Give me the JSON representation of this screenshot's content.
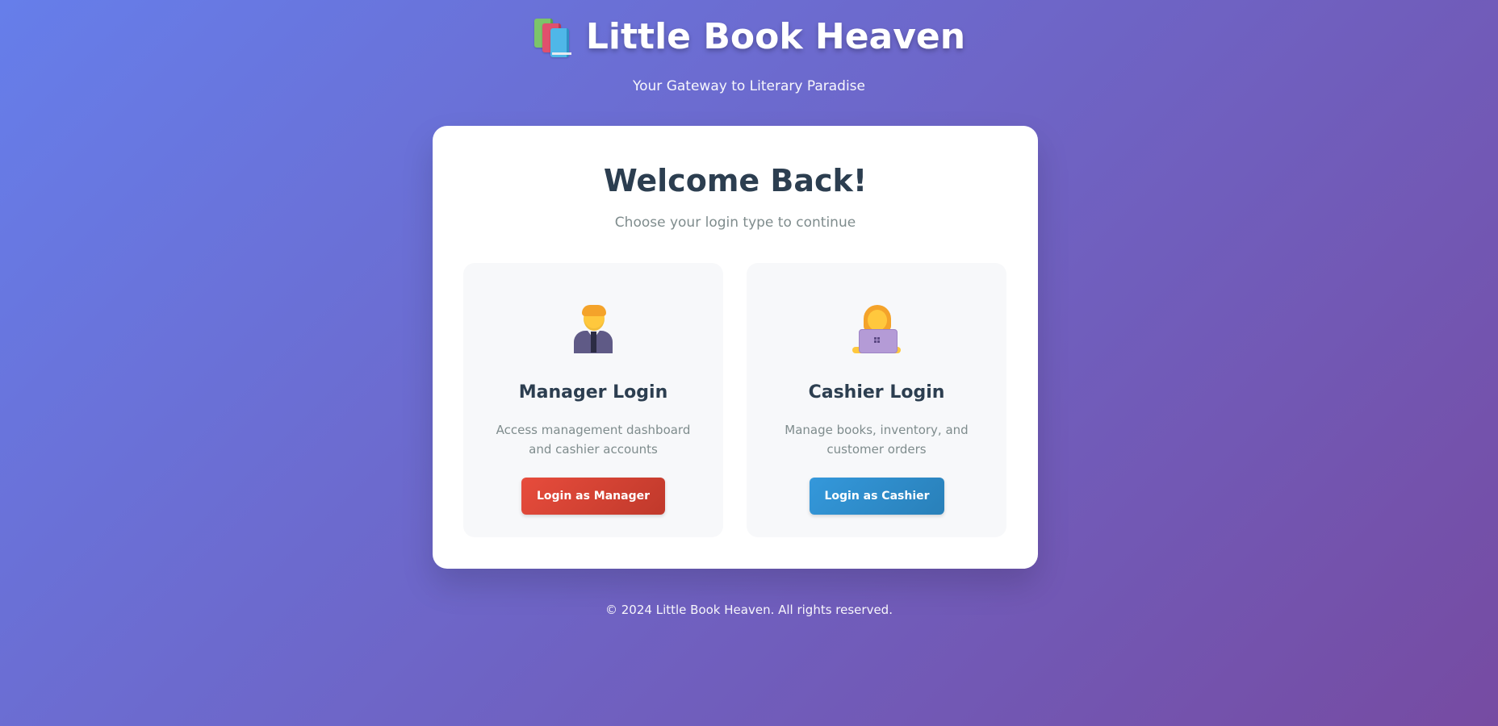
{
  "header": {
    "logo_icon": "books-icon",
    "title": "Little Book Heaven",
    "tagline": "Your Gateway to Literary Paradise"
  },
  "login_card": {
    "title": "Welcome Back!",
    "subtitle": "Choose your login type to continue",
    "options": [
      {
        "icon": "manager-icon",
        "title": "Manager Login",
        "description": "Access management dashboard and cashier accounts",
        "button_label": "Login as Manager",
        "button_color": "#e74c3c"
      },
      {
        "icon": "cashier-icon",
        "title": "Cashier Login",
        "description": "Manage books, inventory, and customer orders",
        "button_label": "Login as Cashier",
        "button_color": "#3498db"
      }
    ]
  },
  "footer": {
    "copyright": "© 2024 Little Book Heaven. All rights reserved."
  },
  "colors": {
    "background_start": "#667eea",
    "background_end": "#764ba2",
    "heading_text": "#2c3e50",
    "muted_text": "#7f8c8d"
  }
}
